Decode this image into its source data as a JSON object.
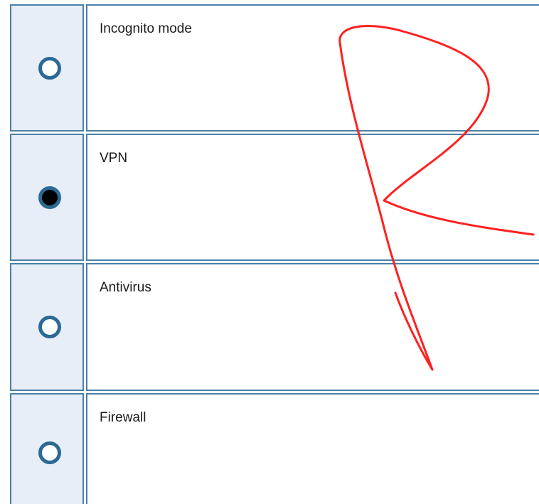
{
  "question": {
    "options": [
      {
        "label": "Incognito mode",
        "selected": false
      },
      {
        "label": "VPN",
        "selected": true
      },
      {
        "label": "Antivirus",
        "selected": false
      },
      {
        "label": "Firewall",
        "selected": false
      }
    ]
  },
  "colors": {
    "border": "#4a80a8",
    "selector_background": "#e8eef7",
    "radio_ring": "#2a6a95",
    "annotation_stroke": "#ff2020"
  },
  "icons": {
    "radio_unselected": "radio-empty-icon",
    "radio_selected": "radio-filled-icon"
  }
}
